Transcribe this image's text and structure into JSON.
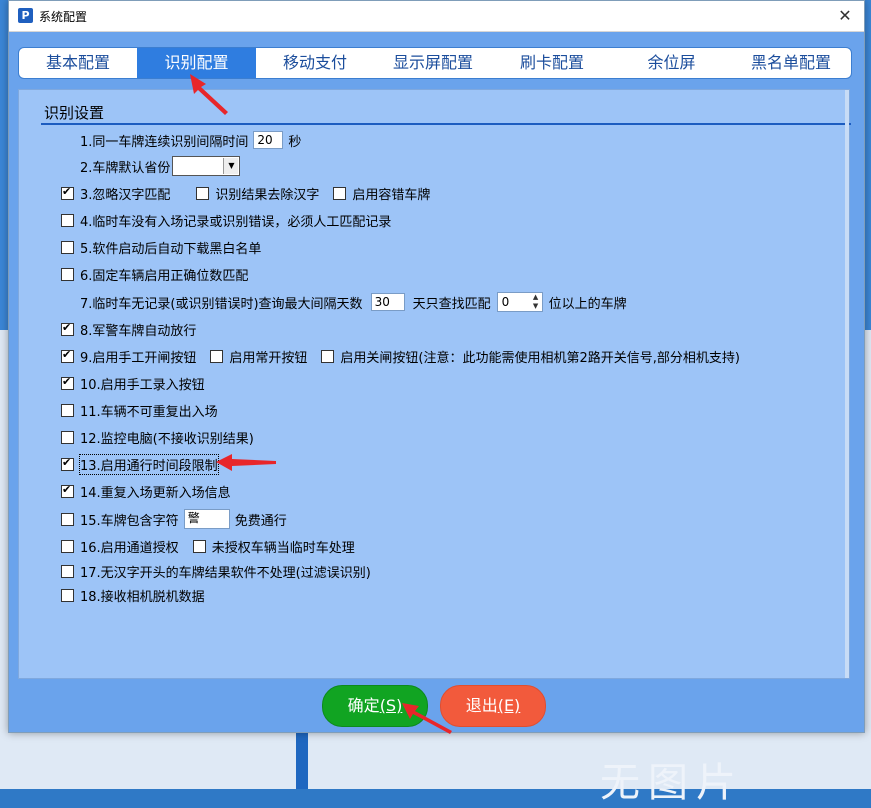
{
  "background": {
    "watermark": "无图片"
  },
  "window": {
    "title": "系统配置",
    "icon_letter": "P",
    "close_glyph": "✕"
  },
  "tabs": [
    {
      "label": "基本配置",
      "active": false
    },
    {
      "label": "识别配置",
      "active": true
    },
    {
      "label": "移动支付",
      "active": false
    },
    {
      "label": "显示屏配置",
      "active": false
    },
    {
      "label": "刷卡配置",
      "active": false
    },
    {
      "label": "余位屏",
      "active": false
    },
    {
      "label": "黑名单配置",
      "active": false
    }
  ],
  "group": {
    "title": "识别设置"
  },
  "settings": {
    "r1": {
      "label": "1.同一车牌连续识别间隔时间",
      "value": "20",
      "unit": "秒"
    },
    "r2": {
      "label": "2.车牌默认省份",
      "value": ""
    },
    "r3": {
      "label": "3.忽略汉字匹配",
      "checked": true,
      "sub1": {
        "label": "识别结果去除汉字",
        "checked": false
      },
      "sub2": {
        "label": "启用容错车牌",
        "checked": false
      }
    },
    "r4": {
      "label": "4.临时车没有入场记录或识别错误，必须人工匹配记录",
      "checked": false
    },
    "r5": {
      "label": "5.软件启动后自动下载黑白名单",
      "checked": false
    },
    "r6": {
      "label": "6.固定车辆启用正确位数匹配",
      "checked": false
    },
    "r7": {
      "label": "7.临时车无记录(或识别错误时)查询最大间隔天数",
      "days": "30",
      "mid": "天只查找匹配",
      "digits": "0",
      "tail": "位以上的车牌"
    },
    "r8": {
      "label": "8.军警车牌自动放行",
      "checked": true
    },
    "r9": {
      "label": "9.启用手工开闸按钮",
      "checked": true,
      "sub1": {
        "label": "启用常开按钮",
        "checked": false
      },
      "sub2": {
        "label": "启用关闸按钮(注意：此功能需使用相机第2路开关信号,部分相机支持)",
        "checked": false
      }
    },
    "r10": {
      "label": "10.启用手工录入按钮",
      "checked": true
    },
    "r11": {
      "label": "11.车辆不可重复出入场",
      "checked": false
    },
    "r12": {
      "label": "12.监控电脑(不接收识别结果)",
      "checked": false
    },
    "r13": {
      "label": "13.启用通行时间段限制",
      "checked": true
    },
    "r14": {
      "label": "14.重复入场更新入场信息",
      "checked": true
    },
    "r15": {
      "label": "15.车牌包含字符",
      "value": "警",
      "tail": "免费通行",
      "checked": false
    },
    "r16": {
      "label": "16.启用通道授权",
      "checked": false,
      "sub1": {
        "label": "未授权车辆当临时车处理",
        "checked": false
      }
    },
    "r17": {
      "label": "17.无汉字开头的车牌结果软件不处理(过滤误识别)",
      "checked": false
    },
    "r18": {
      "label": "18.接收相机脱机数据",
      "checked": false
    }
  },
  "buttons": {
    "ok": "确定",
    "ok_key": "(S)",
    "exit": "退出",
    "exit_key": "(E)"
  },
  "colors": {
    "annotation_arrow": "#e8262a",
    "active_tab": "#2f7de0",
    "ok": "#11a422",
    "exit": "#f25a3c"
  }
}
